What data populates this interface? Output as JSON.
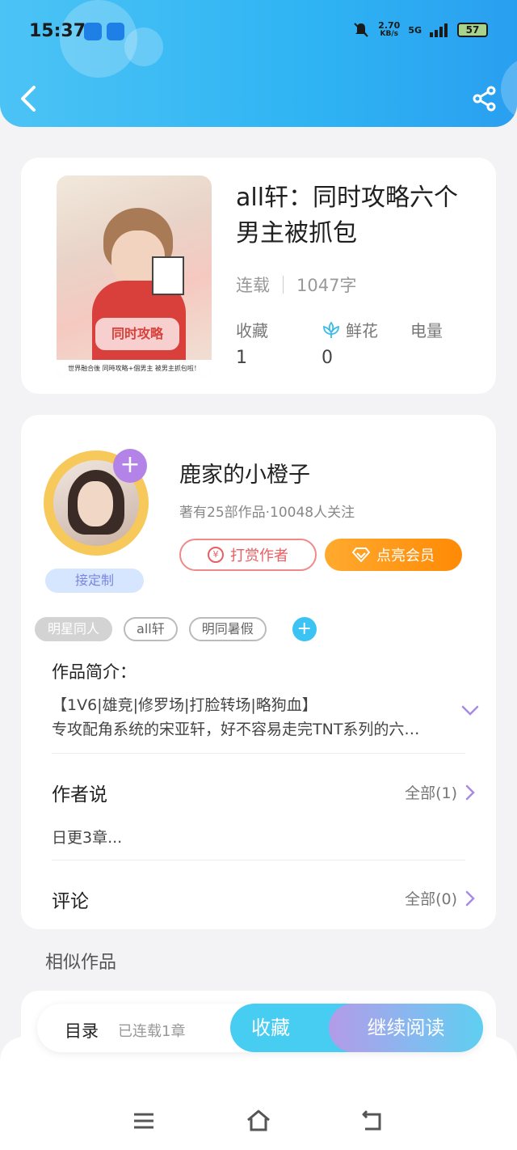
{
  "status_bar": {
    "time": "15:37",
    "speed_value": "2.70",
    "speed_unit": "KB/s",
    "network": "5G",
    "battery": "57",
    "icons": [
      "app-icon",
      "broadcast-icon",
      "mute-bell-icon",
      "signal-icon",
      "battery-icon"
    ]
  },
  "header": {
    "back_icon": "chevron-left-icon",
    "share_icon": "share-icon"
  },
  "book": {
    "title": "all轩：同时攻略六个男主被抓包",
    "status": "连载",
    "word_count": "1047字",
    "cover_art_text": "同时攻略",
    "cover_band_text": "世界融合後 同時攻略+個男主 被男主抓包啦！",
    "stats": [
      {
        "label": "收藏",
        "value": "1",
        "icon": ""
      },
      {
        "label": "鲜花",
        "value": "0",
        "icon": "flower-icon"
      },
      {
        "label": "电量",
        "value": "",
        "icon": ""
      }
    ]
  },
  "author": {
    "name": "鹿家的小橙子",
    "meta": "著有25部作品·10048人关注",
    "follow_icon": "plus-icon",
    "badge": "接定制",
    "tip_button": "打赏作者",
    "vip_button": "点亮会员"
  },
  "tags": [
    "明星同人",
    "all轩",
    "明同暑假"
  ],
  "tag_add_icon": "plus-icon",
  "intro": {
    "label": "作品简介：",
    "line1": "【1V6|雄竞|修罗场|打脸转场|略狗血】",
    "line2": "专攻配角系统的宋亚轩，好不容易走完TNT系列的六…"
  },
  "author_says": {
    "title": "作者说",
    "link": "全部(1)",
    "text": "日更3章..."
  },
  "comments": {
    "title": "评论",
    "link": "全部(0)"
  },
  "similar_title": "相似作品",
  "action_bar": {
    "toc": "目录",
    "toc_status": "已连载1章",
    "favorite": "收藏",
    "continue": "继续阅读"
  },
  "nav": [
    "menu-icon",
    "home-icon",
    "back-icon"
  ]
}
